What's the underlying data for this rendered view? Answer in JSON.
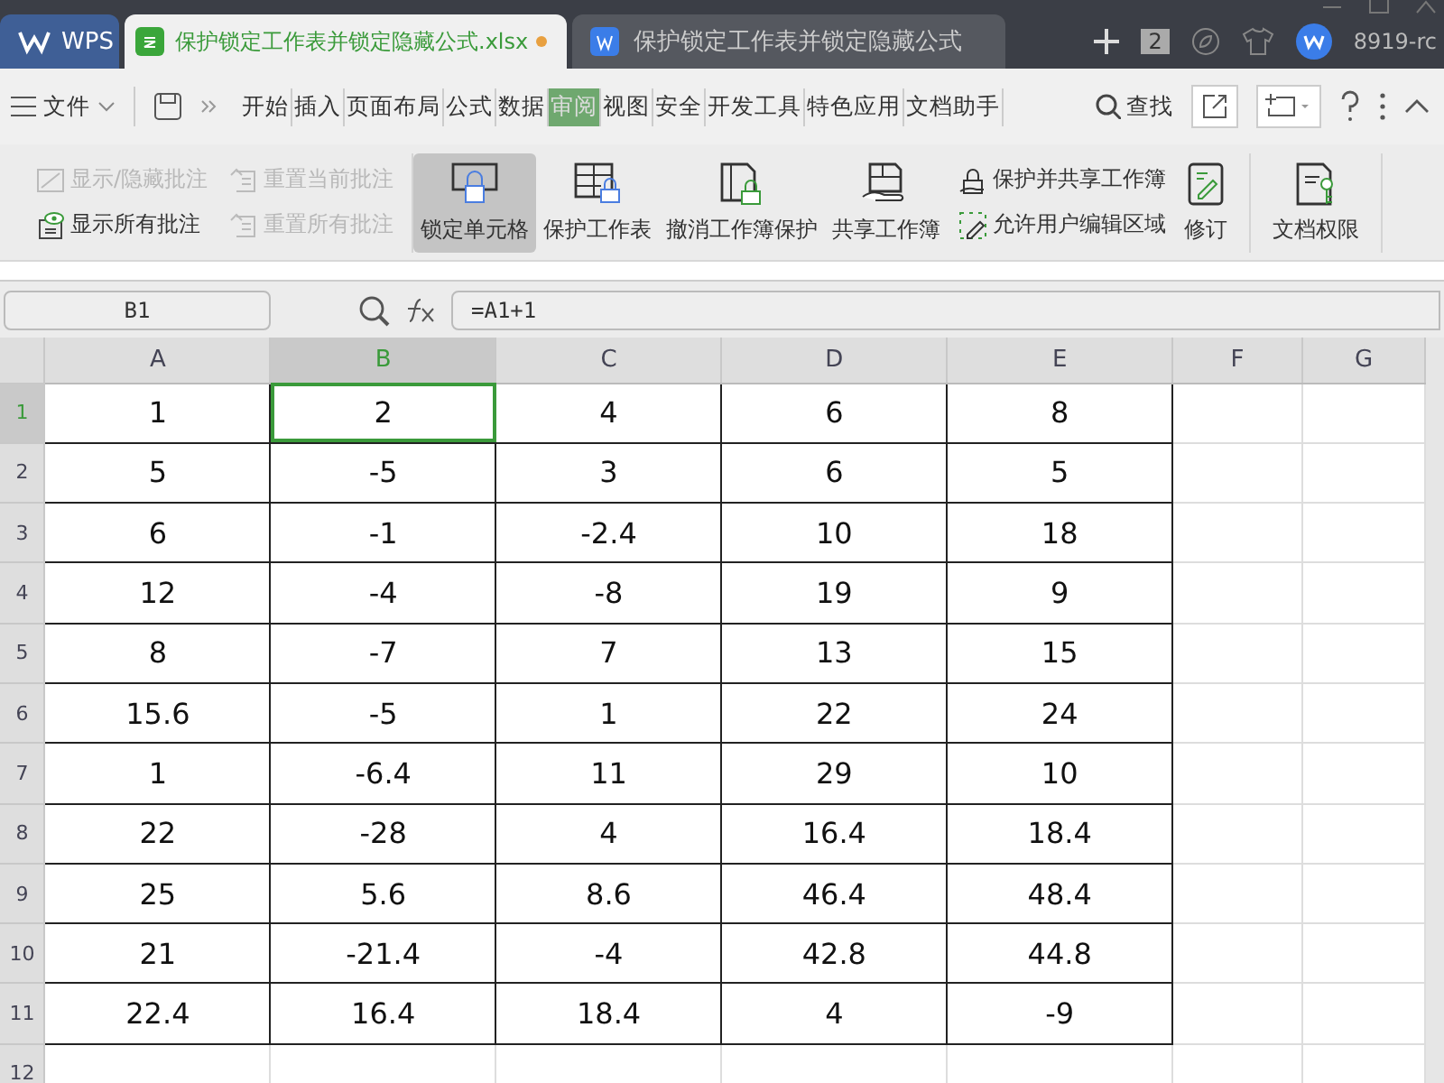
{
  "tabs": [
    {
      "kind": "home",
      "label": "WPS",
      "selected": false,
      "unsaved": false
    },
    {
      "kind": "sheet",
      "label": "保护锁定工作表并锁定隐藏公式.xlsx",
      "selected": true,
      "unsaved": true
    },
    {
      "kind": "doc",
      "label": "保护锁定工作表并锁定隐藏公式",
      "selected": false,
      "unsaved": false
    }
  ],
  "tab_count": "2",
  "user": "8919-rc",
  "menu": {
    "file": "文件",
    "tabs": [
      {
        "label": "开始",
        "selected": false
      },
      {
        "label": "插入",
        "selected": false
      },
      {
        "label": "页面布局",
        "selected": false
      },
      {
        "label": "公式",
        "selected": false
      },
      {
        "label": "数据",
        "selected": false
      },
      {
        "label": "审阅",
        "selected": true
      },
      {
        "label": "视图",
        "selected": false
      },
      {
        "label": "安全",
        "selected": false
      },
      {
        "label": "开发工具",
        "selected": false
      },
      {
        "label": "特色应用",
        "selected": false
      },
      {
        "label": "文档助手",
        "selected": false
      }
    ],
    "search": "查找"
  },
  "ribbon": {
    "comment_buttons": [
      {
        "kind": "toggle",
        "label": "显示/隐藏批注",
        "disabled": true
      },
      {
        "kind": "reset",
        "label": "重置当前批注",
        "disabled": true
      },
      {
        "kind": "show",
        "label": "显示所有批注",
        "disabled": false
      },
      {
        "kind": "reset",
        "label": "重置所有批注",
        "disabled": true
      }
    ],
    "big_buttons": [
      {
        "kind": "lock-cell",
        "label": "锁定单元格",
        "selected": true
      },
      {
        "kind": "protect-sheet",
        "label": "保护工作表",
        "selected": false
      },
      {
        "kind": "unprotect-book",
        "label": "撤消工作簿保护",
        "selected": false
      },
      {
        "kind": "share-book",
        "label": "共享工作簿",
        "selected": false
      }
    ],
    "stacked_buttons": [
      {
        "kind": "lock-share",
        "label": "保护并共享工作簿"
      },
      {
        "kind": "allow-edit",
        "label": "允许用户编辑区域"
      }
    ],
    "revise": "修订",
    "permission": "文档权限"
  },
  "formula_bar": {
    "name_box": "B1",
    "formula": "=A1+1"
  },
  "sheet": {
    "columns": [
      {
        "label": "A",
        "selected": false
      },
      {
        "label": "B",
        "selected": true
      },
      {
        "label": "C",
        "selected": false
      },
      {
        "label": "D",
        "selected": false
      },
      {
        "label": "E",
        "selected": false
      },
      {
        "label": "F",
        "selected": false
      },
      {
        "label": "G",
        "selected": false
      }
    ],
    "rows": [
      {
        "label": "1",
        "selected": true,
        "cells": [
          "1",
          "2",
          "4",
          "6",
          "8"
        ]
      },
      {
        "label": "2",
        "selected": false,
        "cells": [
          "5",
          "-5",
          "3",
          "6",
          "5"
        ]
      },
      {
        "label": "3",
        "selected": false,
        "cells": [
          "6",
          "-1",
          "-2.4",
          "10",
          "18"
        ]
      },
      {
        "label": "4",
        "selected": false,
        "cells": [
          "12",
          "-4",
          "-8",
          "19",
          "9"
        ]
      },
      {
        "label": "5",
        "selected": false,
        "cells": [
          "8",
          "-7",
          "7",
          "13",
          "15"
        ]
      },
      {
        "label": "6",
        "selected": false,
        "cells": [
          "15.6",
          "-5",
          "1",
          "22",
          "24"
        ]
      },
      {
        "label": "7",
        "selected": false,
        "cells": [
          "1",
          "-6.4",
          "11",
          "29",
          "10"
        ]
      },
      {
        "label": "8",
        "selected": false,
        "cells": [
          "22",
          "-28",
          "4",
          "16.4",
          "18.4"
        ]
      },
      {
        "label": "9",
        "selected": false,
        "cells": [
          "25",
          "5.6",
          "8.6",
          "46.4",
          "48.4"
        ]
      },
      {
        "label": "10",
        "selected": false,
        "cells": [
          "21",
          "-21.4",
          "-4",
          "42.8",
          "44.8"
        ]
      },
      {
        "label": "11",
        "selected": false,
        "cells": [
          "22.4",
          "16.4",
          "18.4",
          "4",
          "-9"
        ]
      },
      {
        "label": "12",
        "selected": false,
        "cells": []
      }
    ]
  }
}
